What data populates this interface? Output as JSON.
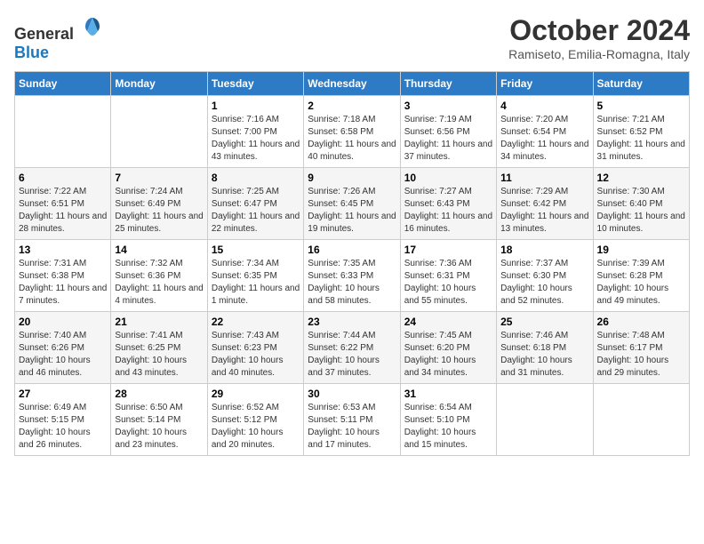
{
  "header": {
    "logo": {
      "text_general": "General",
      "text_blue": "Blue"
    },
    "title": "October 2024",
    "subtitle": "Ramiseto, Emilia-Romagna, Italy"
  },
  "weekdays": [
    "Sunday",
    "Monday",
    "Tuesday",
    "Wednesday",
    "Thursday",
    "Friday",
    "Saturday"
  ],
  "weeks": [
    [
      {
        "day": "",
        "sunrise": "",
        "sunset": "",
        "daylight": ""
      },
      {
        "day": "",
        "sunrise": "",
        "sunset": "",
        "daylight": ""
      },
      {
        "day": "1",
        "sunrise": "Sunrise: 7:16 AM",
        "sunset": "Sunset: 7:00 PM",
        "daylight": "Daylight: 11 hours and 43 minutes."
      },
      {
        "day": "2",
        "sunrise": "Sunrise: 7:18 AM",
        "sunset": "Sunset: 6:58 PM",
        "daylight": "Daylight: 11 hours and 40 minutes."
      },
      {
        "day": "3",
        "sunrise": "Sunrise: 7:19 AM",
        "sunset": "Sunset: 6:56 PM",
        "daylight": "Daylight: 11 hours and 37 minutes."
      },
      {
        "day": "4",
        "sunrise": "Sunrise: 7:20 AM",
        "sunset": "Sunset: 6:54 PM",
        "daylight": "Daylight: 11 hours and 34 minutes."
      },
      {
        "day": "5",
        "sunrise": "Sunrise: 7:21 AM",
        "sunset": "Sunset: 6:52 PM",
        "daylight": "Daylight: 11 hours and 31 minutes."
      }
    ],
    [
      {
        "day": "6",
        "sunrise": "Sunrise: 7:22 AM",
        "sunset": "Sunset: 6:51 PM",
        "daylight": "Daylight: 11 hours and 28 minutes."
      },
      {
        "day": "7",
        "sunrise": "Sunrise: 7:24 AM",
        "sunset": "Sunset: 6:49 PM",
        "daylight": "Daylight: 11 hours and 25 minutes."
      },
      {
        "day": "8",
        "sunrise": "Sunrise: 7:25 AM",
        "sunset": "Sunset: 6:47 PM",
        "daylight": "Daylight: 11 hours and 22 minutes."
      },
      {
        "day": "9",
        "sunrise": "Sunrise: 7:26 AM",
        "sunset": "Sunset: 6:45 PM",
        "daylight": "Daylight: 11 hours and 19 minutes."
      },
      {
        "day": "10",
        "sunrise": "Sunrise: 7:27 AM",
        "sunset": "Sunset: 6:43 PM",
        "daylight": "Daylight: 11 hours and 16 minutes."
      },
      {
        "day": "11",
        "sunrise": "Sunrise: 7:29 AM",
        "sunset": "Sunset: 6:42 PM",
        "daylight": "Daylight: 11 hours and 13 minutes."
      },
      {
        "day": "12",
        "sunrise": "Sunrise: 7:30 AM",
        "sunset": "Sunset: 6:40 PM",
        "daylight": "Daylight: 11 hours and 10 minutes."
      }
    ],
    [
      {
        "day": "13",
        "sunrise": "Sunrise: 7:31 AM",
        "sunset": "Sunset: 6:38 PM",
        "daylight": "Daylight: 11 hours and 7 minutes."
      },
      {
        "day": "14",
        "sunrise": "Sunrise: 7:32 AM",
        "sunset": "Sunset: 6:36 PM",
        "daylight": "Daylight: 11 hours and 4 minutes."
      },
      {
        "day": "15",
        "sunrise": "Sunrise: 7:34 AM",
        "sunset": "Sunset: 6:35 PM",
        "daylight": "Daylight: 11 hours and 1 minute."
      },
      {
        "day": "16",
        "sunrise": "Sunrise: 7:35 AM",
        "sunset": "Sunset: 6:33 PM",
        "daylight": "Daylight: 10 hours and 58 minutes."
      },
      {
        "day": "17",
        "sunrise": "Sunrise: 7:36 AM",
        "sunset": "Sunset: 6:31 PM",
        "daylight": "Daylight: 10 hours and 55 minutes."
      },
      {
        "day": "18",
        "sunrise": "Sunrise: 7:37 AM",
        "sunset": "Sunset: 6:30 PM",
        "daylight": "Daylight: 10 hours and 52 minutes."
      },
      {
        "day": "19",
        "sunrise": "Sunrise: 7:39 AM",
        "sunset": "Sunset: 6:28 PM",
        "daylight": "Daylight: 10 hours and 49 minutes."
      }
    ],
    [
      {
        "day": "20",
        "sunrise": "Sunrise: 7:40 AM",
        "sunset": "Sunset: 6:26 PM",
        "daylight": "Daylight: 10 hours and 46 minutes."
      },
      {
        "day": "21",
        "sunrise": "Sunrise: 7:41 AM",
        "sunset": "Sunset: 6:25 PM",
        "daylight": "Daylight: 10 hours and 43 minutes."
      },
      {
        "day": "22",
        "sunrise": "Sunrise: 7:43 AM",
        "sunset": "Sunset: 6:23 PM",
        "daylight": "Daylight: 10 hours and 40 minutes."
      },
      {
        "day": "23",
        "sunrise": "Sunrise: 7:44 AM",
        "sunset": "Sunset: 6:22 PM",
        "daylight": "Daylight: 10 hours and 37 minutes."
      },
      {
        "day": "24",
        "sunrise": "Sunrise: 7:45 AM",
        "sunset": "Sunset: 6:20 PM",
        "daylight": "Daylight: 10 hours and 34 minutes."
      },
      {
        "day": "25",
        "sunrise": "Sunrise: 7:46 AM",
        "sunset": "Sunset: 6:18 PM",
        "daylight": "Daylight: 10 hours and 31 minutes."
      },
      {
        "day": "26",
        "sunrise": "Sunrise: 7:48 AM",
        "sunset": "Sunset: 6:17 PM",
        "daylight": "Daylight: 10 hours and 29 minutes."
      }
    ],
    [
      {
        "day": "27",
        "sunrise": "Sunrise: 6:49 AM",
        "sunset": "Sunset: 5:15 PM",
        "daylight": "Daylight: 10 hours and 26 minutes."
      },
      {
        "day": "28",
        "sunrise": "Sunrise: 6:50 AM",
        "sunset": "Sunset: 5:14 PM",
        "daylight": "Daylight: 10 hours and 23 minutes."
      },
      {
        "day": "29",
        "sunrise": "Sunrise: 6:52 AM",
        "sunset": "Sunset: 5:12 PM",
        "daylight": "Daylight: 10 hours and 20 minutes."
      },
      {
        "day": "30",
        "sunrise": "Sunrise: 6:53 AM",
        "sunset": "Sunset: 5:11 PM",
        "daylight": "Daylight: 10 hours and 17 minutes."
      },
      {
        "day": "31",
        "sunrise": "Sunrise: 6:54 AM",
        "sunset": "Sunset: 5:10 PM",
        "daylight": "Daylight: 10 hours and 15 minutes."
      },
      {
        "day": "",
        "sunrise": "",
        "sunset": "",
        "daylight": ""
      },
      {
        "day": "",
        "sunrise": "",
        "sunset": "",
        "daylight": ""
      }
    ]
  ]
}
